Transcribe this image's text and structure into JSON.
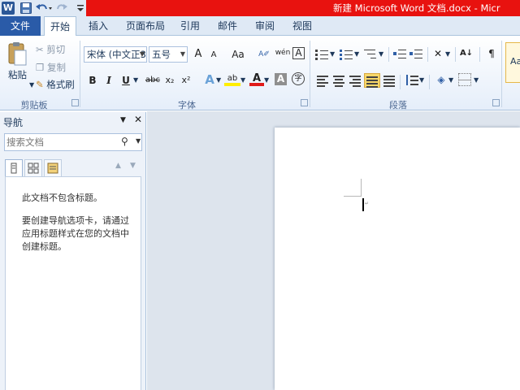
{
  "window": {
    "title": "新建 Microsoft Word 文档.docx - Micr",
    "app_logo": "W"
  },
  "qat": {
    "icons": [
      "save-icon",
      "undo-icon",
      "redo-icon",
      "customize-qat-icon"
    ]
  },
  "tabs": {
    "file": "文件",
    "items": [
      "开始",
      "插入",
      "页面布局",
      "引用",
      "邮件",
      "审阅",
      "视图"
    ],
    "active": "开始"
  },
  "clipboard": {
    "label": "剪贴板",
    "paste": "粘贴",
    "cut": "剪切",
    "copy": "复制",
    "format_painter": "格式刷"
  },
  "font": {
    "label": "字体",
    "font_name": "宋体 (中文正3",
    "font_size": "五号",
    "grow": "A",
    "shrink": "A",
    "change_case": "Aa",
    "bold": "B",
    "italic": "I",
    "underline": "U",
    "strikethrough": "abc",
    "subscript": "x₂",
    "superscript": "x²",
    "effects": "A",
    "highlight": "ab",
    "font_color": "A",
    "char_shading": "A",
    "enclose": "字",
    "phonetic": "wén",
    "border_char": "A"
  },
  "paragraph": {
    "label": "段落"
  },
  "styles": {
    "preview": "Aa"
  },
  "nav": {
    "title": "导航",
    "search_placeholder": "搜索文档",
    "message1": "此文档不包含标题。",
    "message2": "要创建导航选项卡，请通过应用标题样式在您的文档中创建标题。"
  },
  "colors": {
    "file_tab": "#2a5ba8",
    "title_bar": "#e8120f",
    "ribbon_bg": "#dfe9f5",
    "doc_bg": "#dde4ed",
    "highlight_active": "#f7d76a"
  }
}
